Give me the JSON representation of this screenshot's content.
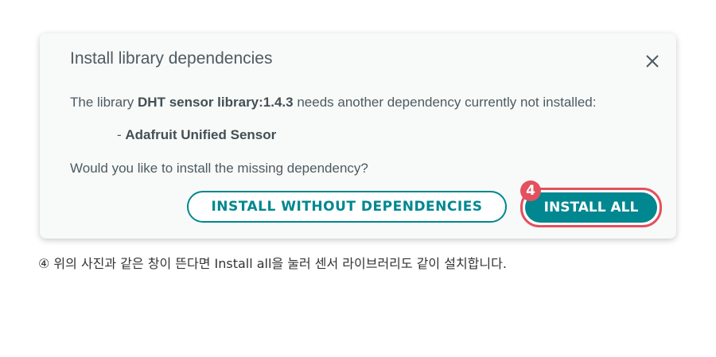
{
  "dialog": {
    "title": "Install library dependencies",
    "message_prefix": "The library ",
    "library_name": "DHT sensor library:1.4.3",
    "message_suffix": " needs another dependency currently not installed:",
    "dependency_prefix": "- ",
    "dependency_name": "Adafruit Unified Sensor",
    "question": "Would you like to install the missing dependency?",
    "install_without_label": "INSTALL WITHOUT DEPENDENCIES",
    "install_all_label": "INSTALL ALL",
    "close_icon": "close-icon"
  },
  "annotation": {
    "step_number": "4",
    "caption": "④ 위의 사진과 같은 창이 뜬다면 Install all을 눌러 센서 라이브러리도 같이 설치합니다."
  },
  "colors": {
    "accent": "#00878f",
    "highlight": "#e3505e",
    "text": "#4e5b61"
  }
}
